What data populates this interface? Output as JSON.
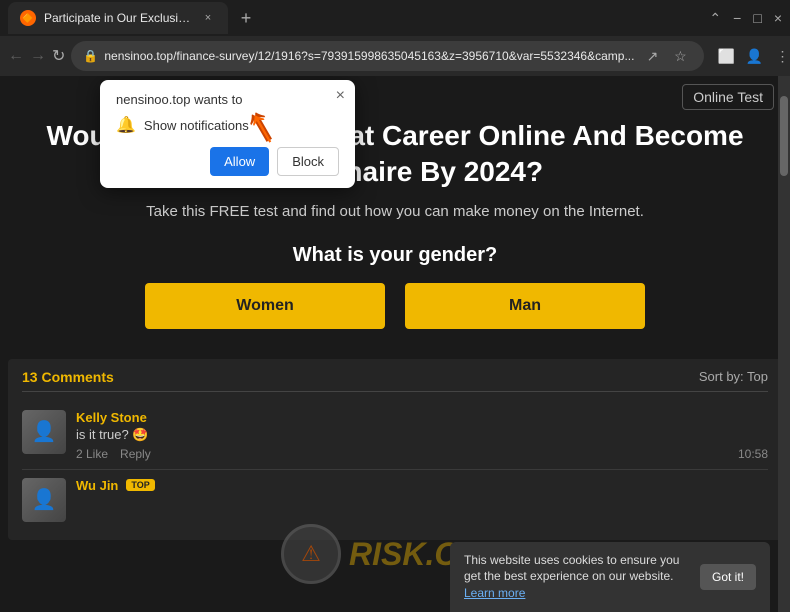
{
  "browser": {
    "tab": {
      "title": "Participate in Our Exclusive Onli...",
      "favicon": "🔶",
      "close": "×"
    },
    "new_tab_label": "+",
    "controls": {
      "minimize": "−",
      "maximize": "□",
      "close": "×"
    },
    "address": {
      "url": "nensinoo.top/finance-survey/12/1916?s=793915998635045163&z=3956710&var=5532346&camp...",
      "lock": "🔒"
    },
    "nav": {
      "back": "←",
      "forward": "→",
      "refresh": "↻"
    }
  },
  "notification_popup": {
    "site_text": "nensinoo.top wants to",
    "close": "×",
    "bell_label": "Show notifications",
    "allow_label": "Allow",
    "block_label": "Block"
  },
  "page": {
    "online_test_label": "Online Test",
    "headline": "Would You Make A Great Career Online And Become A Millionaire By 2024?",
    "subheadline": "Take this FREE test and find out how you can make money on the Internet.",
    "gender_question": "What is your gender?",
    "women_button": "Women",
    "man_button": "Man"
  },
  "comments": {
    "count_label": "13 Comments",
    "sort_label": "Sort by: Top",
    "items": [
      {
        "username": "Kelly Stone",
        "text": "is it true? 🤩",
        "likes": "2 Like",
        "reply": "Reply",
        "time": "10:58"
      },
      {
        "username": "Wu Jin",
        "badge": "TOP",
        "text": ""
      }
    ]
  },
  "cookie_banner": {
    "text": "This website uses cookies to ensure you get the best experience on our website.",
    "link_text": "Learn more",
    "button_label": "Got it!"
  },
  "watermark": {
    "text": "RISK.COM"
  }
}
